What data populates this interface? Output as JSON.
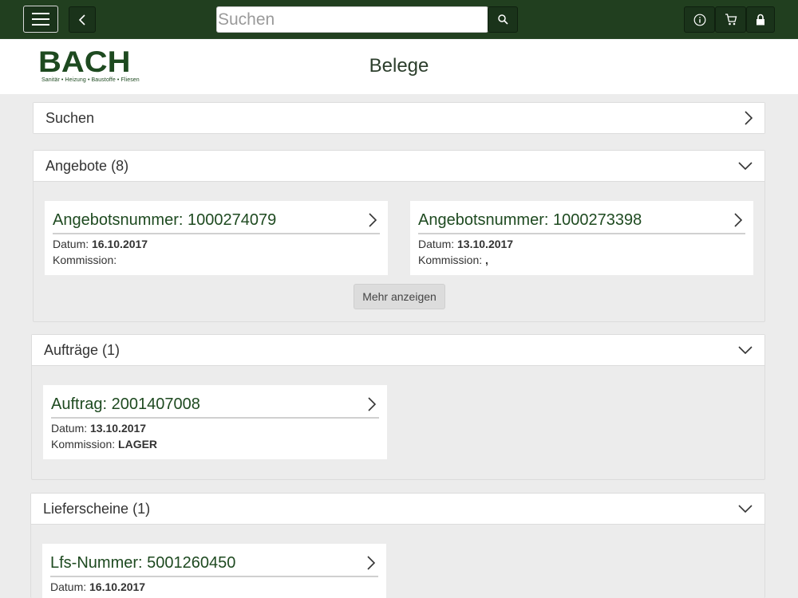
{
  "topbar": {
    "search_placeholder": "Suchen",
    "search_value": ""
  },
  "brand": {
    "name": "BACH",
    "tagline": "Sanitär • Heizung • Baustoffe • Fliesen"
  },
  "page": {
    "title": "Belege"
  },
  "search_panel": {
    "label": "Suchen"
  },
  "angebote": {
    "header": "Angebote (8)",
    "cards": [
      {
        "title": "Angebotsnummer: 1000274079",
        "datum_label": "Datum:",
        "datum": "16.10.2017",
        "kommission_label": "Kommission:",
        "kommission": ""
      },
      {
        "title": "Angebotsnummer: 1000273398",
        "datum_label": "Datum:",
        "datum": "13.10.2017",
        "kommission_label": "Kommission:",
        "kommission": ","
      }
    ],
    "more_label": "Mehr anzeigen"
  },
  "auftraege": {
    "header": "Aufträge (1)",
    "cards": [
      {
        "title": "Auftrag: 2001407008",
        "datum_label": "Datum:",
        "datum": "13.10.2017",
        "kommission_label": "Kommission:",
        "kommission": "LAGER"
      }
    ]
  },
  "lieferscheine": {
    "header": "Lieferscheine (1)",
    "cards": [
      {
        "title": "Lfs-Nummer: 5001260450",
        "datum_label": "Datum:",
        "datum": "16.10.2017"
      }
    ]
  },
  "colors": {
    "topbar": "#213f1f",
    "brand_green": "#1e4a20",
    "background": "#ececec"
  }
}
